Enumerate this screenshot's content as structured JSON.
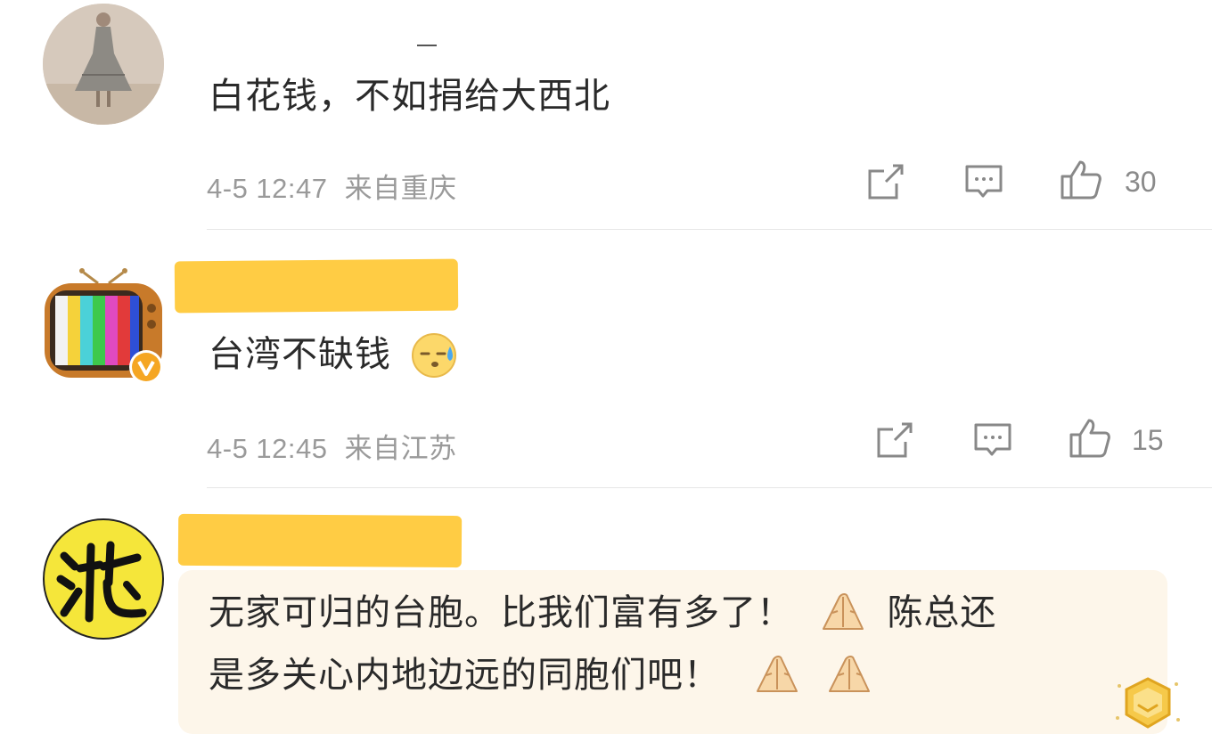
{
  "comments": [
    {
      "text": "白花钱，不如捐给大西北",
      "timestamp": "4-5 12:47",
      "location": "来自重庆",
      "likes": "30",
      "avatar": "woman-in-dress-avatar",
      "verified": false
    },
    {
      "text": "台湾不缺钱",
      "emoji": "sweat-face-emoji",
      "timestamp": "4-5 12:45",
      "location": "来自江苏",
      "likes": "15",
      "avatar": "retro-tv-avatar",
      "verified": true
    },
    {
      "text_line1": "无家可归的台胞。比我们富有多了！",
      "text_line1b": "陈总还",
      "text_line2": "是多关心内地边远的同胞们吧！",
      "emoji": "folded-hands-emoji",
      "avatar": "calligraphy-avatar",
      "verified": false,
      "badge": "gold-hexagon-badge"
    }
  ],
  "colors": {
    "highlight": "#ffc93a",
    "meta": "#9a9a9a",
    "verified_badge": "#f5a623",
    "comment3_bg": "#fdf6ea"
  },
  "icons": {
    "share": "share-icon",
    "comment": "comment-icon",
    "like": "thumbs-up-icon"
  }
}
